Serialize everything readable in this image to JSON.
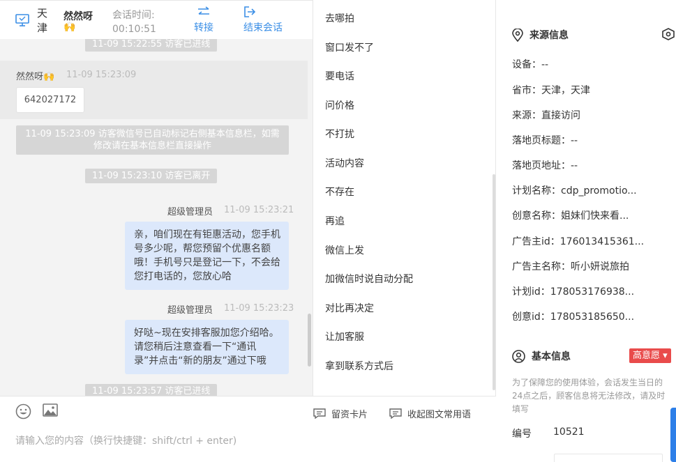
{
  "header": {
    "city": "天津",
    "name": "然然呀",
    "avatar_emoji": "🙌",
    "time_label": "会话时间:",
    "time_value": "00:10:51",
    "transfer_label": "转接",
    "end_label": "结束会话"
  },
  "chat": {
    "sys1": "11-09 15:22:55 访客已进线",
    "visitor_name": "然然呀🙌",
    "visitor_time": "11-09 15:23:09",
    "visitor_msg": "642027172",
    "sys2": "11-09 15:23:09 访客微信号已自动标记右侧基本信息栏，如需修改请在基本信息栏直接操作",
    "sys3": "11-09 15:23:10 访客已离开",
    "agent1_name": "超级管理员",
    "agent1_time": "11-09 15:23:21",
    "agent1_msg": "亲，咱们现在有钜惠活动，您手机号多少呢，帮您预留个优惠名额哦！手机号只是登记一下，不会给您打电话的，您放心哈",
    "agent2_name": "超级管理员",
    "agent2_time": "11-09 15:23:23",
    "agent2_msg": "好哒~现在安排客服加您介绍哈。请您稍后注意查看一下“通讯录”并点击“新的朋友”通过下哦",
    "sys4": "11-09 15:23:57 访客已进线"
  },
  "input": {
    "card_label": "留资卡片",
    "quick_label": "收起图文常用语",
    "placeholder": "请输入您的内容（换行快捷键：shift/ctrl + enter)"
  },
  "quick_replies": [
    "去哪拍",
    "窗口发不了",
    "要电话",
    "问价格",
    "不打扰",
    "活动内容",
    "不存在",
    "再追",
    "微信上发",
    "加微信时说自动分配",
    "对比再决定",
    "让加客服",
    "拿到联系方式后"
  ],
  "panel": {
    "source_title": "来源信息",
    "rows": [
      "设备：--",
      "省市：天津，天津",
      "来源：直接访问",
      "落地页标题：--",
      "落地页地址：--",
      "计划名称：cdp_promotio...",
      "创意名称：姐妹们快来看...",
      "广告主id：176013415361...",
      "广告主名称：听小妍说旅拍",
      "计划id：178053176938...",
      "创意id：178053185650..."
    ],
    "basic_title": "基本信息",
    "intent_badge": "高意愿 ▾",
    "notice": "为了保障您的使用体验，会话发生当日的24点之后，顾客信息将无法修改，请及时填写",
    "number_label": "编号",
    "number_value": "10521"
  },
  "colors": {
    "accent": "#3a8ee6",
    "badge": "#e94b4b",
    "agent_bubble": "#dce8fb",
    "system_tag": "#d6d6d6"
  }
}
